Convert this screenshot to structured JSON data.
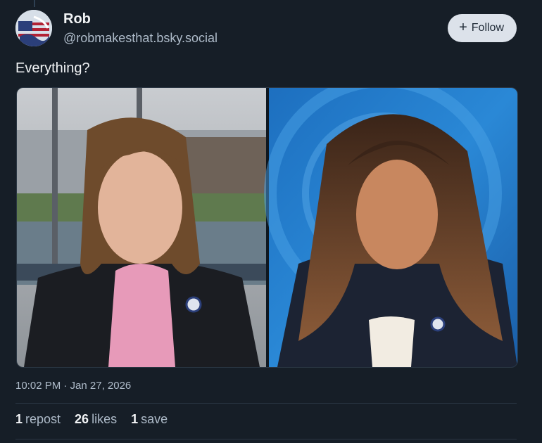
{
  "post": {
    "author": {
      "display_name": "Rob",
      "handle": "@robmakesthat.bsky.social"
    },
    "follow_label": "Follow",
    "text": "Everything?",
    "timestamp": "10:02 PM · Jan 27, 2026",
    "stats": {
      "reposts_count": "1",
      "reposts_label": "repost",
      "likes_count": "26",
      "likes_label": "likes",
      "saves_count": "1",
      "saves_label": "save"
    }
  },
  "colors": {
    "background": "#161e27",
    "follow_button": "#dce2ea",
    "muted_text": "#aebbc9"
  },
  "icons": {
    "follow": "plus-icon",
    "avatar": "flag-avatar"
  }
}
